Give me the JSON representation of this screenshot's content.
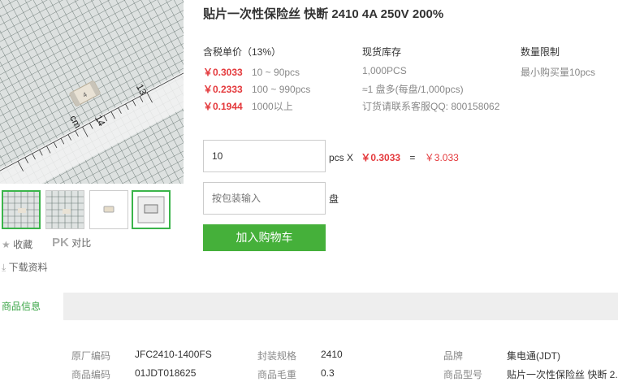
{
  "product": {
    "title": "贴片一次性保险丝 快断 2410 4A 250V 200%"
  },
  "image": {
    "ruler_label_left": "cm",
    "ruler_number_left": "14",
    "ruler_number_right": "13",
    "chip_mark": "4"
  },
  "actions": {
    "favorite_label": "收藏",
    "compare_prefix": "PK",
    "compare_label": "对比",
    "download_label": "下载资料"
  },
  "pricing": {
    "header": "含税单价（13%）",
    "tiers": [
      {
        "price": "￥0.3033",
        "qty": "10 ~ 90pcs"
      },
      {
        "price": "￥0.2333",
        "qty": "100 ~ 990pcs"
      },
      {
        "price": "￥0.1944",
        "qty": "1000以上"
      }
    ]
  },
  "stock": {
    "header": "现货库存",
    "amount": "1,000PCS",
    "reel": "≈1 盘多(每盘/1,000pcs)",
    "contact": "订货请联系客服QQ: 800158062"
  },
  "limit": {
    "header": "数量限制",
    "value": "最小购买量10pcs"
  },
  "order": {
    "qty_value": "10",
    "unit_label": "pcs X",
    "unit_price": "￥0.3033",
    "equals": "=",
    "total": "￥3.033",
    "pack_placeholder": "按包装输入",
    "pack_unit": "盘",
    "add_to_cart": "加入购物车"
  },
  "tabs": {
    "product_info": "商品信息"
  },
  "specs": [
    {
      "k": "原厂编码",
      "v": "JFC2410-1400FS"
    },
    {
      "k": "封装规格",
      "v": "2410"
    },
    {
      "k": "品牌",
      "v": "集电通(JDT)"
    },
    {
      "k": "商品编码",
      "v": "01JDT018625"
    },
    {
      "k": "商品毛重",
      "v": "0.3"
    },
    {
      "k": "商品型号",
      "v": "贴片一次性保险丝 快断 2."
    }
  ],
  "colors": {
    "price_red": "#e4393c",
    "cart_green": "#45b03a",
    "tab_green": "#3aa546"
  }
}
